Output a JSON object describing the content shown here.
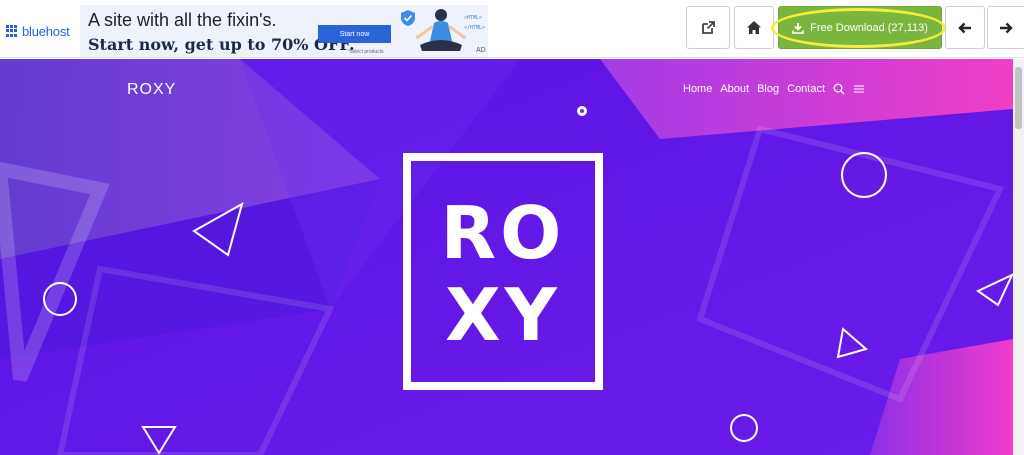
{
  "ad": {
    "brand": "bluehost",
    "headline": "A site with all the fixin's.",
    "offer": "Start now, get up to 70% OFF.",
    "cta": "Start now",
    "fine_print": "*select products",
    "ad_mark": "AD",
    "illustration_tags": [
      "<HTML>",
      "</HTML>"
    ]
  },
  "toolbar": {
    "external_icon": "external-link-icon",
    "home_icon": "home-icon",
    "download_icon": "download-icon",
    "download_label": "Free Download (27,113)",
    "back_icon": "arrow-left-icon",
    "forward_icon": "arrow-right-icon",
    "highlight_color": "#f5ec3a",
    "download_color": "#7ab63e"
  },
  "preview": {
    "logo": "ROXY",
    "nav": [
      "Home",
      "About",
      "Blog",
      "Contact"
    ],
    "nav_icons": [
      "search-icon",
      "menu-icon"
    ],
    "hero_logo_lines": [
      "RO",
      "XY"
    ],
    "colors": {
      "base": "#5b16e6",
      "accent_pink": "#f53bcf",
      "accent_purple": "#8a3ef0"
    }
  }
}
